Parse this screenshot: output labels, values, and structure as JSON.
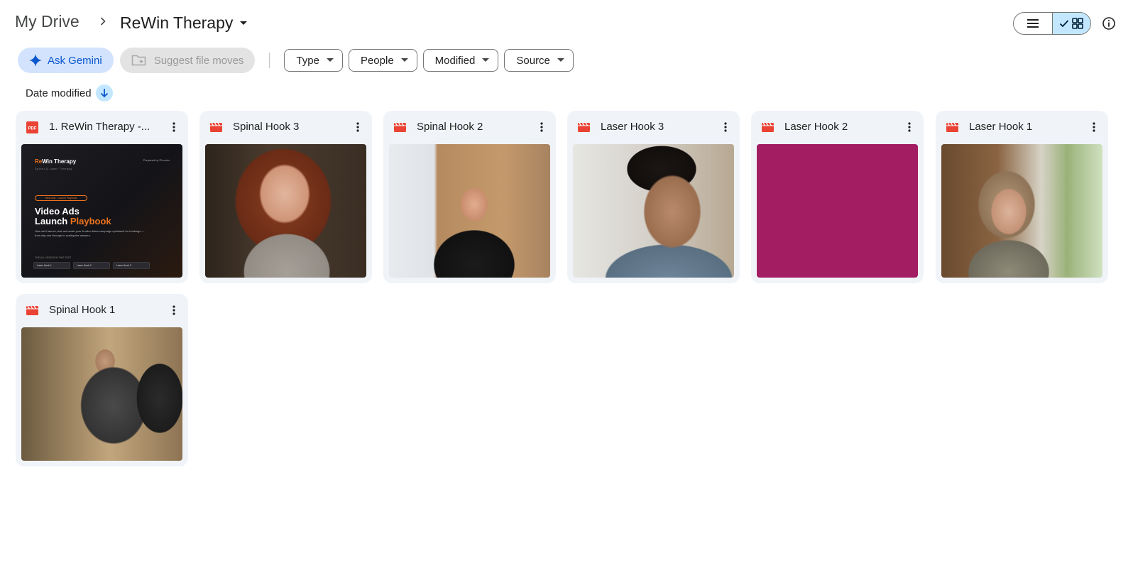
{
  "breadcrumb": {
    "root": "My Drive",
    "current": "ReWin Therapy"
  },
  "toolbar": {
    "ask_gemini": "Ask Gemini",
    "suggest_moves": "Suggest file moves",
    "filters": [
      "Type",
      "People",
      "Modified",
      "Source"
    ]
  },
  "sort": {
    "label": "Date modified",
    "direction": "descending"
  },
  "view": {
    "mode": "grid"
  },
  "colors": {
    "accent": "#0b57d0",
    "selected_bg": "#c2e7ff",
    "card_bg": "#f0f4f9",
    "file_icon_red": "#ea4335"
  },
  "files": [
    {
      "name": "1. ReWin Therapy -...",
      "type": "pdf",
      "icon": "pdf-icon"
    },
    {
      "name": "Spinal Hook 3",
      "type": "video",
      "icon": "video-icon"
    },
    {
      "name": "Spinal Hook 2",
      "type": "video",
      "icon": "video-icon"
    },
    {
      "name": "Laser Hook 3",
      "type": "video",
      "icon": "video-icon"
    },
    {
      "name": "Laser Hook 2",
      "type": "video",
      "icon": "video-icon"
    },
    {
      "name": "Laser Hook 1",
      "type": "video",
      "icon": "video-icon"
    },
    {
      "name": "Spinal Hook 1",
      "type": "video",
      "icon": "video-icon"
    }
  ],
  "pdf_preview": {
    "brand_a": "Re",
    "brand_b": "Win",
    "brand_c": " Therapy",
    "tagline": "Spinal & Laser Therapy",
    "prepared": "Prepared by Phoenix",
    "pill": "Meta Ads · Launch Playbook",
    "heading_a": "Video Ads",
    "heading_b": "Launch ",
    "heading_c": "Playbook",
    "description": "How we'll launch, test and scale your 6-video Meta campaign optimised for bookings — from day one through to scaling the winners.",
    "small": "THE ALL VIDEOS IN THIS TEST",
    "boxes": [
      "Laser Hook 1",
      "Laser Hook 2",
      "Laser Hook 3"
    ]
  }
}
